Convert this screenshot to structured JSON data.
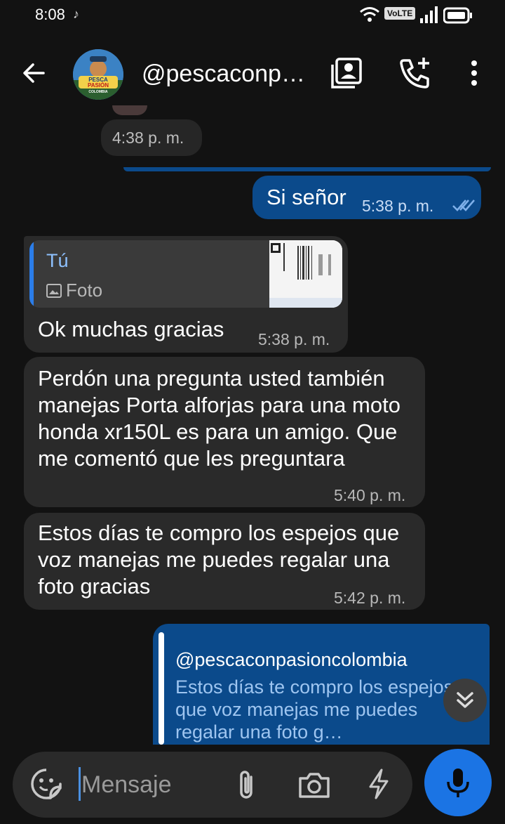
{
  "status_bar": {
    "time": "8:08",
    "volte": "VoLTE"
  },
  "header": {
    "contact_name": "@pescaconpasioncolombia",
    "avatar_text_line1": "PESCA",
    "avatar_text_line2": "PASIÓN",
    "avatar_text_line3": "COLOMBIA"
  },
  "messages": {
    "time_chip": "4:38 p. m.",
    "msg1": {
      "text": "Si señor",
      "time": "5:38 p. m.",
      "read": true
    },
    "msg2": {
      "quote_author": "Tú",
      "quote_type": "Foto",
      "text": "Ok muchas gracias",
      "time": "5:38 p. m."
    },
    "msg3": {
      "text": "Perdón una pregunta  usted también manejas   Porta alforjas para una moto honda xr150L es para un amigo. Que me comentó que les preguntara",
      "time": "5:40 p. m."
    },
    "msg4": {
      "text": "Estos días te compro los espejos que voz manejas me puedes regalar una foto gracias",
      "time": "5:42 p. m."
    },
    "msg5": {
      "quote_author": "@pescaconpasioncolombia",
      "quote_text": "Estos días te compro los espejos que voz manejas me puedes regalar una foto g…"
    }
  },
  "composer": {
    "placeholder": "Mensaje"
  },
  "colors": {
    "accent_blue": "#1b74e4",
    "outgoing_bubble": "#0b4a8b",
    "incoming_bubble": "#2a2a2a",
    "background": "#121212"
  },
  "icons": [
    "tiktok-icon",
    "wifi-icon",
    "signal-icon",
    "battery-icon",
    "back-arrow-icon",
    "contact-card-icon",
    "add-call-icon",
    "more-vert-icon",
    "double-check-icon",
    "image-icon",
    "chevrons-down-icon",
    "sticker-icon",
    "paperclip-icon",
    "camera-icon",
    "flash-icon",
    "mic-icon"
  ]
}
